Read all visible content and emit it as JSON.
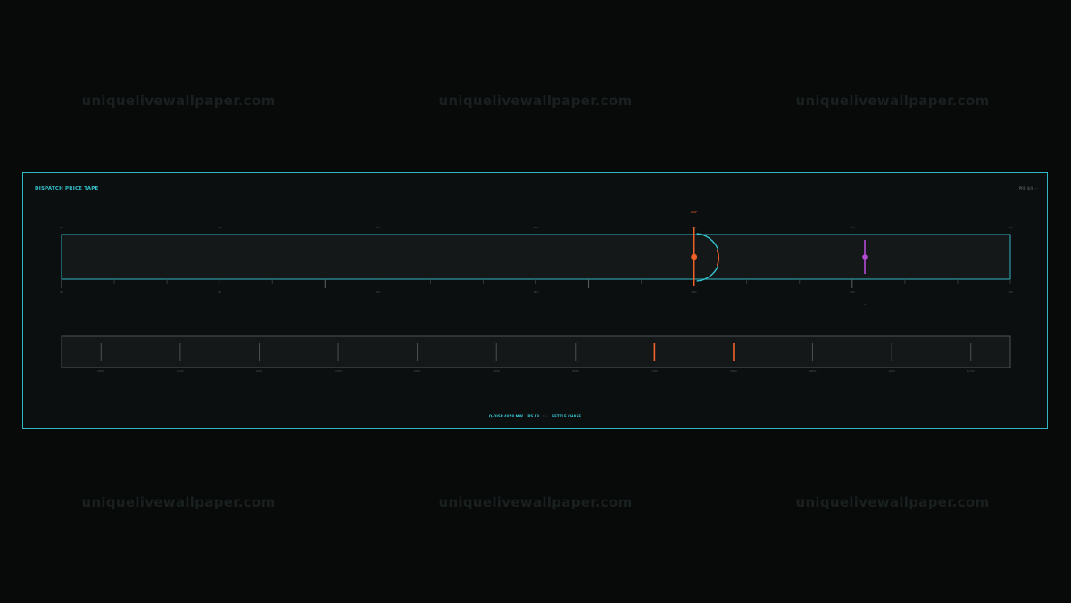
{
  "watermark": "uniquelivewallpaper.com",
  "panel": {
    "title": "DISPATCH PRICE TAPE",
    "meta_value": "PRP 4/4",
    "meta_unit": "—"
  },
  "colors": {
    "background": "#080a0a",
    "panel_border": "#2fb7c4",
    "accent_cyan": "#35c4d0",
    "marker_orange": "#f0622a",
    "marker_violet": "#b24ad4",
    "tick_gray": "#3a4142"
  },
  "tape": {
    "top_labels": [
      "80",
      "90",
      "100",
      "110",
      "120",
      "130",
      "140"
    ],
    "bottom_labels": [
      "80",
      "90",
      "100",
      "110",
      "120",
      "130",
      "140"
    ],
    "range": [
      80,
      140
    ],
    "dispatch_marker": {
      "label": "DISP",
      "value": 120.0
    },
    "ref_marker": {
      "label": "—",
      "value": 130.8
    }
  },
  "strip": {
    "labels": [
      "0000",
      "0100",
      "0200",
      "0300",
      "0400",
      "0500",
      "0600",
      "0700",
      "0800",
      "0900",
      "1000",
      "1100"
    ],
    "highlighted": [
      7,
      8
    ]
  },
  "footer": {
    "dispatch": "Q-DISP 4858 MW",
    "ps": "PS 43",
    "ps_unit": "kv",
    "mode": "SETTLE CHASE"
  }
}
